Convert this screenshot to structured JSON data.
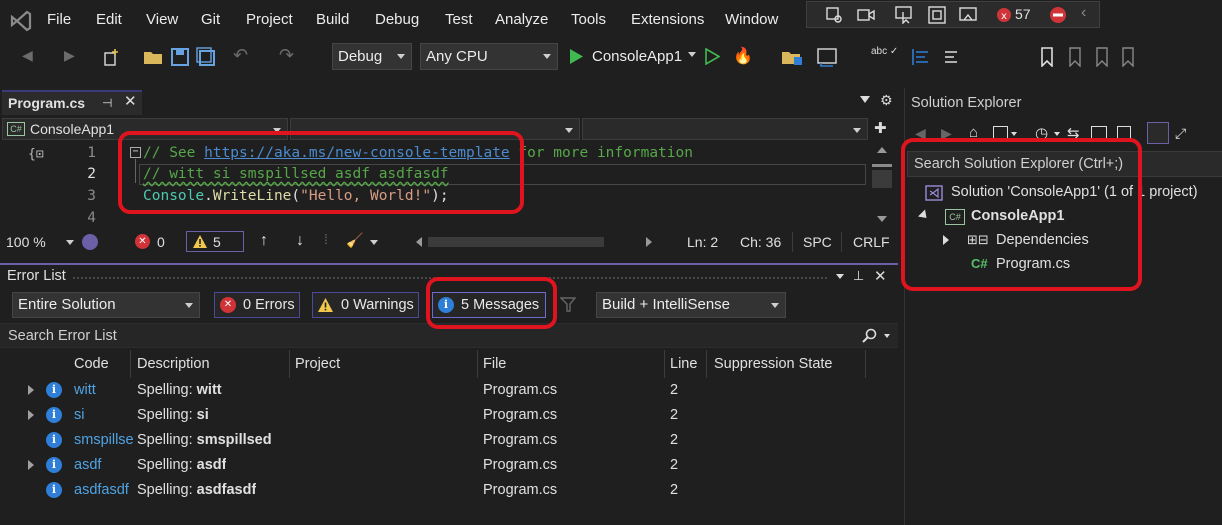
{
  "menu": [
    "File",
    "Edit",
    "View",
    "Git",
    "Project",
    "Build",
    "Debug",
    "Test",
    "Analyze",
    "Tools",
    "Extensions",
    "Window"
  ],
  "toolbox": {
    "issues_count": "57"
  },
  "toolbar": {
    "configuration": "Debug",
    "platform": "Any CPU",
    "start_target": "ConsoleApp1"
  },
  "editor": {
    "tab_title": "Program.cs",
    "nav_project": "ConsoleApp1",
    "line_numbers": [
      "1",
      "2",
      "3",
      "4"
    ],
    "code": {
      "line1_prefix": "// See ",
      "line1_link": "https://aka.ms/new-console-template",
      "line1_suffix": " for more information",
      "line2": "// witt si smspillsed asdf asdfasdf",
      "line3_class": "Console",
      "line3_dot": ".",
      "line3_method": "WriteLine",
      "line3_open": "(",
      "line3_string": "\"Hello, World!\"",
      "line3_close": ");"
    }
  },
  "editor_status": {
    "zoom": "100 %",
    "errors": "0",
    "warnings": "5",
    "line": "Ln: 2",
    "column": "Ch: 36",
    "whitespace": "SPC",
    "line_ending": "CRLF"
  },
  "error_list": {
    "title": "Error List",
    "scope": "Entire Solution",
    "errors_label": "0 Errors",
    "warnings_label": "0 Warnings",
    "messages_label": "5 Messages",
    "source": "Build + IntelliSense",
    "search_placeholder": "Search Error List",
    "columns": [
      "Code",
      "Description",
      "Project",
      "File",
      "Line",
      "Suppression State"
    ],
    "rows": [
      {
        "code": "witt",
        "desc_prefix": "Spelling: ",
        "desc_word": "witt",
        "project": "",
        "file": "Program.cs",
        "line": "2",
        "expandable": true
      },
      {
        "code": "si",
        "desc_prefix": "Spelling: ",
        "desc_word": "si",
        "project": "",
        "file": "Program.cs",
        "line": "2",
        "expandable": true
      },
      {
        "code": "smspillse",
        "desc_prefix": "Spelling: ",
        "desc_word": "smspillsed",
        "project": "",
        "file": "Program.cs",
        "line": "2",
        "expandable": false
      },
      {
        "code": "asdf",
        "desc_prefix": "Spelling: ",
        "desc_word": "asdf",
        "project": "",
        "file": "Program.cs",
        "line": "2",
        "expandable": true
      },
      {
        "code": "asdfasdf",
        "desc_prefix": "Spelling: ",
        "desc_word": "asdfasdf",
        "project": "",
        "file": "Program.cs",
        "line": "2",
        "expandable": false
      }
    ]
  },
  "solution_explorer": {
    "title": "Solution Explorer",
    "search_placeholder": "Search Solution Explorer (Ctrl+;)",
    "solution": "Solution 'ConsoleApp1' (1 of 1 project)",
    "project": "ConsoleApp1",
    "dependencies": "Dependencies",
    "file": "Program.cs"
  },
  "colors": {
    "accent": "#6b5fa8",
    "annotation": "#e0141e",
    "info": "#2f7ed8",
    "error": "#d13438",
    "warning": "#f2c94c"
  }
}
